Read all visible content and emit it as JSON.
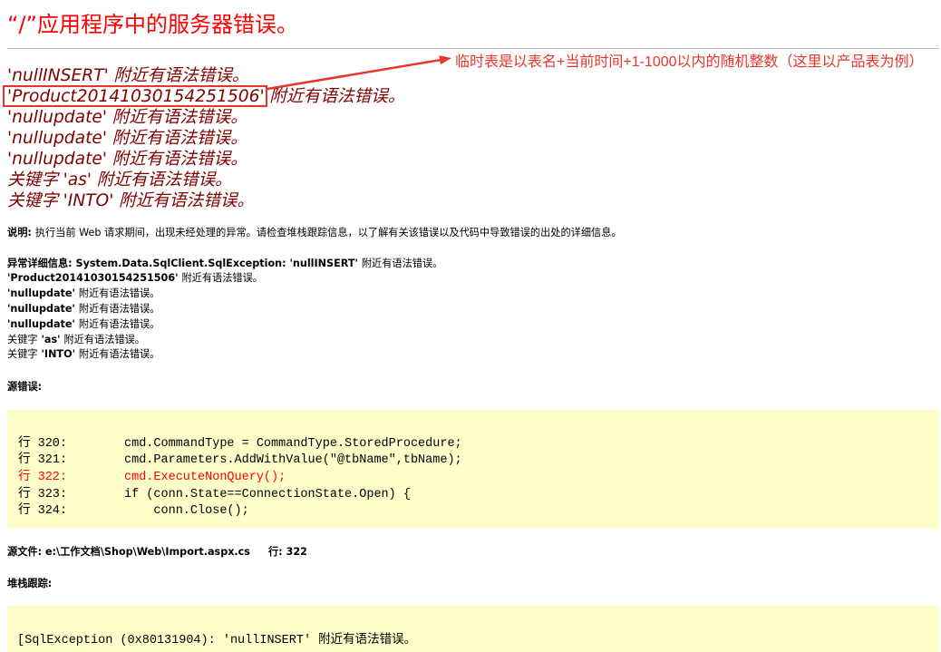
{
  "colors": {
    "title": "#ff0000",
    "heading": "#800000",
    "annotation": "#e8352b",
    "divider": "#c0c0c0",
    "code_background": "#ffffcc",
    "highlight": "#ff0000"
  },
  "page": {
    "title": "“/”应用程序中的服务器错误。"
  },
  "annotation": {
    "note": "临时表是以表名+当前时间+1-1000以内的随机整数（这里以产品表为例）"
  },
  "errors": [
    {
      "token": "'nullINSERT'",
      "suffix": "附近有语法错误。"
    },
    {
      "token": "'Product20141030154251506'",
      "suffix": "附近有语法错误。"
    },
    {
      "token": "'nullupdate'",
      "suffix": "附近有语法错误。"
    },
    {
      "token": "'nullupdate'",
      "suffix": "附近有语法错误。"
    },
    {
      "token": "'nullupdate'",
      "suffix": "附近有语法错误。"
    },
    {
      "prefix": "关键字",
      "token": "'as'",
      "suffix": "附近有语法错误。"
    },
    {
      "prefix": "关键字",
      "token": "'INTO'",
      "suffix": "附近有语法错误。"
    }
  ],
  "description": {
    "label": "说明:",
    "text": "执行当前 Web 请求期间，出现未经处理的异常。请检查堆栈跟踪信息，以了解有关该错误以及代码中导致错误的出处的详细信息。"
  },
  "exception_details": {
    "label": "异常详细信息:",
    "type": "System.Data.SqlClient.SqlException:"
  },
  "source_error": {
    "label": "源错误:",
    "lines": [
      {
        "label": "行 320:",
        "code": "cmd.CommandType = CommandType.StoredProcedure;",
        "highlight": false
      },
      {
        "label": "行 321:",
        "code": "cmd.Parameters.AddWithValue(\"@tbName\",tbName);",
        "highlight": false
      },
      {
        "label": "行 322:",
        "code": "cmd.ExecuteNonQuery();",
        "highlight": true
      },
      {
        "label": "行 323:",
        "code": "if (conn.State==ConnectionState.Open) {",
        "highlight": false
      },
      {
        "label": "行 324:",
        "code": "    conn.Close();",
        "highlight": false
      }
    ]
  },
  "source_file": {
    "label": "源文件:",
    "path": "e:\\工作文档\\Shop\\Web\\Import.aspx.cs",
    "line_label": "行:",
    "line": "322"
  },
  "stack_trace": {
    "label": "堆栈跟踪:",
    "lines": [
      "[SqlException (0x80131904): 'nullINSERT' 附近有语法错误。"
    ]
  }
}
